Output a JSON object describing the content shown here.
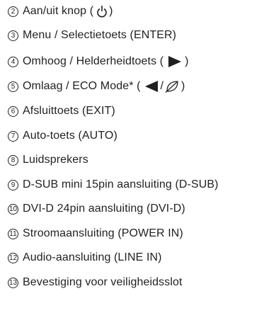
{
  "items": [
    {
      "num": "2",
      "pre": "Aan/uit knop (",
      "icon": "power-icon",
      "post": ")"
    },
    {
      "num": "3",
      "text": "Menu / Selectietoets (ENTER)"
    },
    {
      "num": "4",
      "pre": "Omhoog / Helderheidtoets (",
      "icon": "triangle-right-icon",
      "post": ")"
    },
    {
      "num": "5",
      "pre": "Omlaag / ECO Mode* (",
      "icon": "triangle-left-icon",
      "sep": "/",
      "icon2": "eco-leaf-icon",
      "post": ")"
    },
    {
      "num": "6",
      "text": "Afsluittoets (EXIT)"
    },
    {
      "num": "7",
      "text": "Auto-toets (AUTO)"
    },
    {
      "num": "8",
      "text": "Luidsprekers"
    },
    {
      "num": "9",
      "text": "D-SUB mini 15pin aansluiting (D-SUB)"
    },
    {
      "num": "10",
      "text": "DVI-D 24pin aansluiting (DVI-D)"
    },
    {
      "num": "11",
      "text": "Stroomaansluiting (POWER IN)"
    },
    {
      "num": "12",
      "text": "Audio-aansluiting (LINE IN)"
    },
    {
      "num": "13",
      "text": "Bevestiging voor veiligheidsslot"
    }
  ]
}
